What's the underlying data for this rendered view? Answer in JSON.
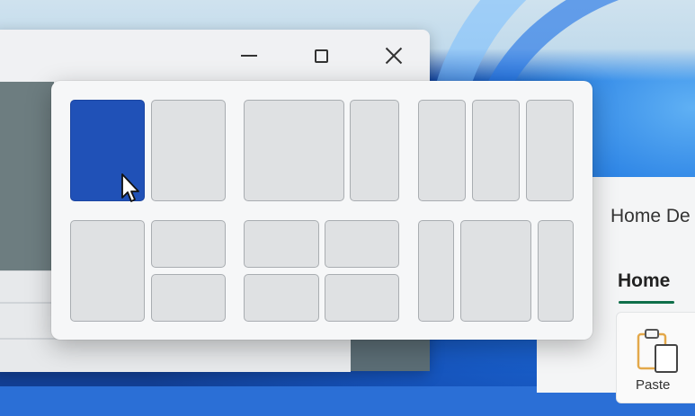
{
  "window": {
    "minimize_glyph": "minimize-icon",
    "maximize_glyph": "maximize-icon",
    "close_glyph": "close-icon"
  },
  "app": {
    "doc_title": "Home De",
    "tab_home": "Home",
    "paste_label": "Paste",
    "accent": "#0f6f4a"
  },
  "snap_layouts": {
    "active_color": "#2051b7",
    "layouts": [
      {
        "name": "two-halves",
        "zones": 2,
        "active_zone": 0
      },
      {
        "name": "two-thirds-one-third",
        "zones": 2
      },
      {
        "name": "three-columns",
        "zones": 3
      },
      {
        "name": "half-and-two-quarters",
        "zones": 3
      },
      {
        "name": "four-quarters",
        "zones": 4
      },
      {
        "name": "wide-center-three",
        "zones": 3
      }
    ]
  }
}
